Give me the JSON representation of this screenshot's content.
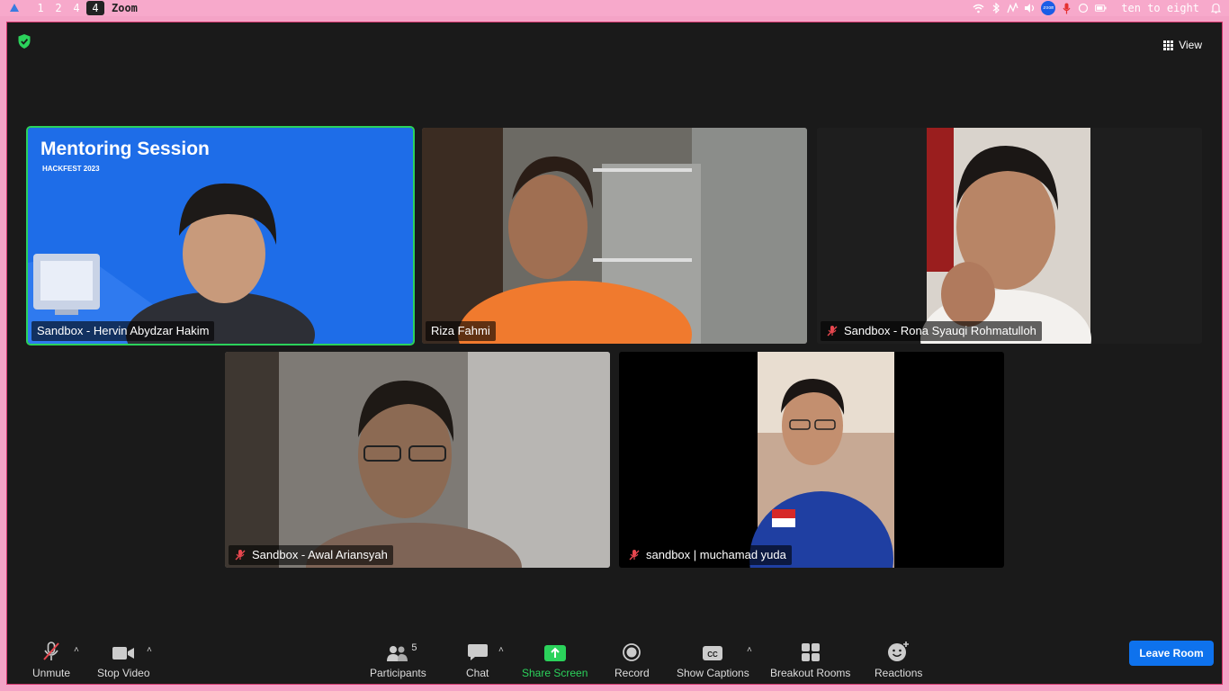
{
  "topbar": {
    "workspaces": [
      "1",
      "2",
      "4"
    ],
    "active_workspace": "4",
    "window_title": "Zoom",
    "clock": "ten to eight"
  },
  "meeting": {
    "view_label": "View",
    "encryption_icon": "shield-check-icon"
  },
  "participants": [
    {
      "name": "Sandbox - Hervin Abydzar Hakim",
      "muted": false,
      "active_speaker": true,
      "slide": {
        "title": "Mentoring Session",
        "subtitle": "HACKFEST 2023"
      }
    },
    {
      "name": "Riza Fahmi",
      "muted": false,
      "active_speaker": false
    },
    {
      "name": "Sandbox - Rona Syauqi Rohmatulloh",
      "muted": true,
      "active_speaker": false
    },
    {
      "name": "Sandbox - Awal Ariansyah",
      "muted": true,
      "active_speaker": false
    },
    {
      "name": "sandbox | muchamad yuda",
      "muted": true,
      "active_speaker": false
    }
  ],
  "toolbar": {
    "unmute": "Unmute",
    "stop_video": "Stop Video",
    "participants": "Participants",
    "participants_count": "5",
    "chat": "Chat",
    "share_screen": "Share Screen",
    "record": "Record",
    "show_captions": "Show Captions",
    "breakout_rooms": "Breakout Rooms",
    "reactions": "Reactions",
    "leave_room": "Leave Room"
  },
  "colors": {
    "active_speaker_border": "#2bd25b",
    "leave_button": "#0e72ed",
    "share_screen": "#2bd25b",
    "muted_icon": "#e8474f",
    "window_border": "#d3356d"
  }
}
